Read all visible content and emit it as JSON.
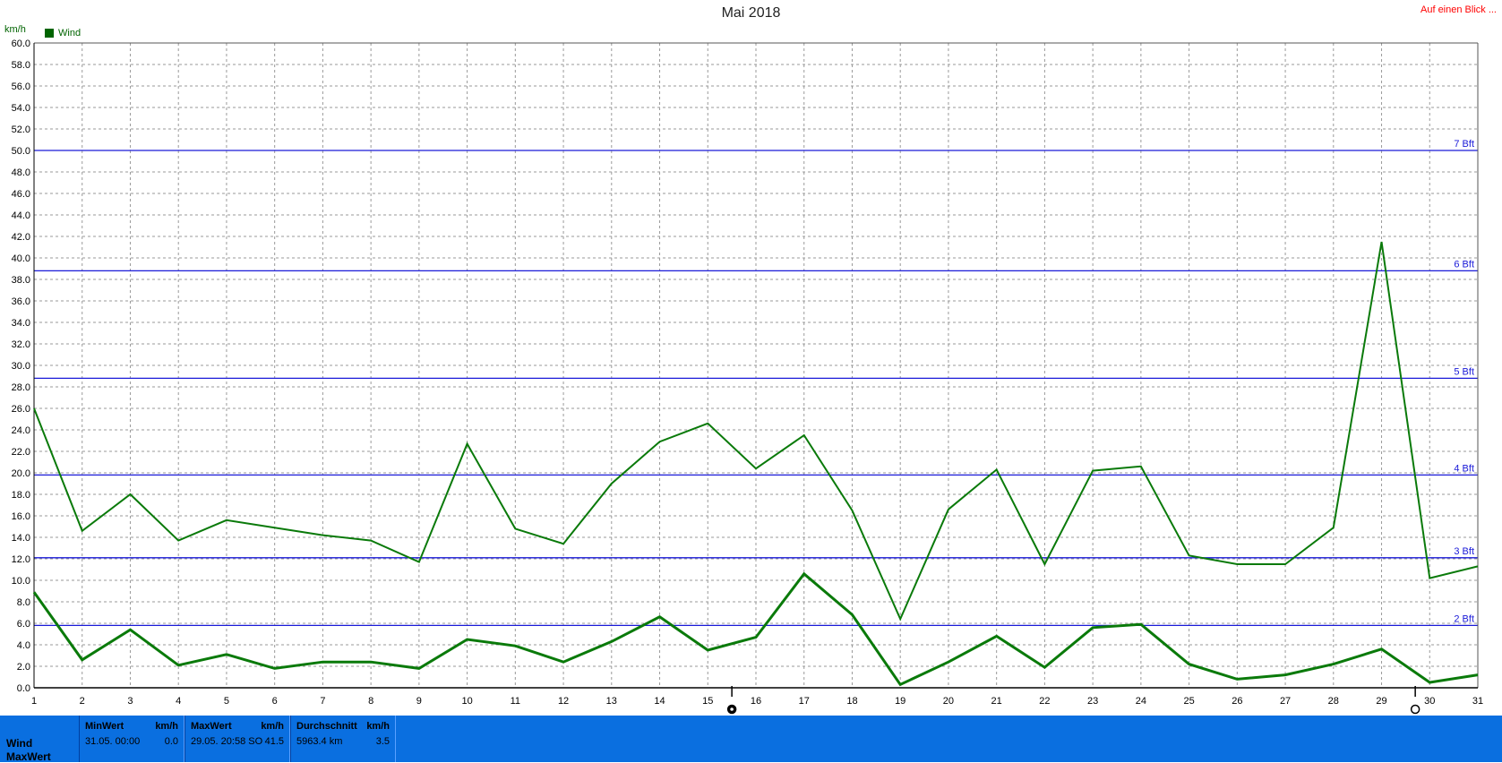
{
  "header": {
    "title": "Mai 2018",
    "link_label": "Auf einen Blick ..."
  },
  "chart_data": {
    "type": "line",
    "title": "Mai 2018",
    "ylabel": "km/h",
    "ylim": [
      0,
      60
    ],
    "yticks": [
      "0.0",
      "2.0",
      "4.0",
      "6.0",
      "8.0",
      "10.0",
      "12.0",
      "14.0",
      "16.0",
      "18.0",
      "20.0",
      "22.0",
      "24.0",
      "26.0",
      "28.0",
      "30.0",
      "32.0",
      "34.0",
      "36.0",
      "38.0",
      "40.0",
      "42.0",
      "44.0",
      "46.0",
      "48.0",
      "50.0",
      "52.0",
      "54.0",
      "56.0",
      "58.0",
      "60.0"
    ],
    "x": [
      1,
      2,
      3,
      4,
      5,
      6,
      7,
      8,
      9,
      10,
      11,
      12,
      13,
      14,
      15,
      16,
      17,
      18,
      19,
      20,
      21,
      22,
      23,
      24,
      25,
      26,
      27,
      28,
      29,
      30,
      31
    ],
    "grid": true,
    "legend": [
      {
        "name": "Wind",
        "position": "top-left"
      }
    ],
    "series": [
      {
        "name": "Wind MaxWert",
        "color": "#0a7a0a",
        "values": [
          26.0,
          14.6,
          18.0,
          13.7,
          15.6,
          14.9,
          14.2,
          13.7,
          11.7,
          22.7,
          14.8,
          13.4,
          19.0,
          22.9,
          24.6,
          20.4,
          23.5,
          16.5,
          6.4,
          16.6,
          20.3,
          11.5,
          20.2,
          20.6,
          12.3,
          11.5,
          11.5,
          14.9,
          41.5,
          10.2,
          11.3
        ]
      },
      {
        "name": "Wind",
        "color": "#0a7a0a",
        "values": [
          8.9,
          2.6,
          5.4,
          2.1,
          3.1,
          1.8,
          2.4,
          2.4,
          1.8,
          4.5,
          3.9,
          2.4,
          4.3,
          6.6,
          3.5,
          4.7,
          10.6,
          6.8,
          0.3,
          2.4,
          4.8,
          1.9,
          5.6,
          5.9,
          2.2,
          0.8,
          1.2,
          2.2,
          3.6,
          0.5,
          1.2
        ]
      }
    ],
    "reference_lines": [
      {
        "label": "2 Bft",
        "value": 5.8,
        "color": "#1a1ad8"
      },
      {
        "label": "3 Bft",
        "value": 12.1,
        "color": "#1a1ad8"
      },
      {
        "label": "4 Bft",
        "value": 19.8,
        "color": "#1a1ad8"
      },
      {
        "label": "5 Bft",
        "value": 28.8,
        "color": "#1a1ad8"
      },
      {
        "label": "6 Bft",
        "value": 38.8,
        "color": "#1a1ad8"
      },
      {
        "label": "7 Bft",
        "value": 50.0,
        "color": "#1a1ad8"
      }
    ],
    "markers": [
      {
        "day": 15.5,
        "icon": "full-moon-icon"
      },
      {
        "day": 29.7,
        "icon": "new-moon-icon"
      }
    ]
  },
  "footer": {
    "row_labels": [
      "Wind",
      "MaxWert"
    ],
    "min": {
      "header": "MinWert",
      "unit": "km/h",
      "date": "31.05.",
      "time": "00:00",
      "value": "0.0"
    },
    "max": {
      "header": "MaxWert",
      "unit": "km/h",
      "date": "29.05.",
      "time": "20:58",
      "dir": "SO",
      "value": "41.5"
    },
    "avg": {
      "header": "Durchschnitt",
      "unit": "km/h",
      "distance": "5963.4 km",
      "value": "3.5"
    }
  }
}
